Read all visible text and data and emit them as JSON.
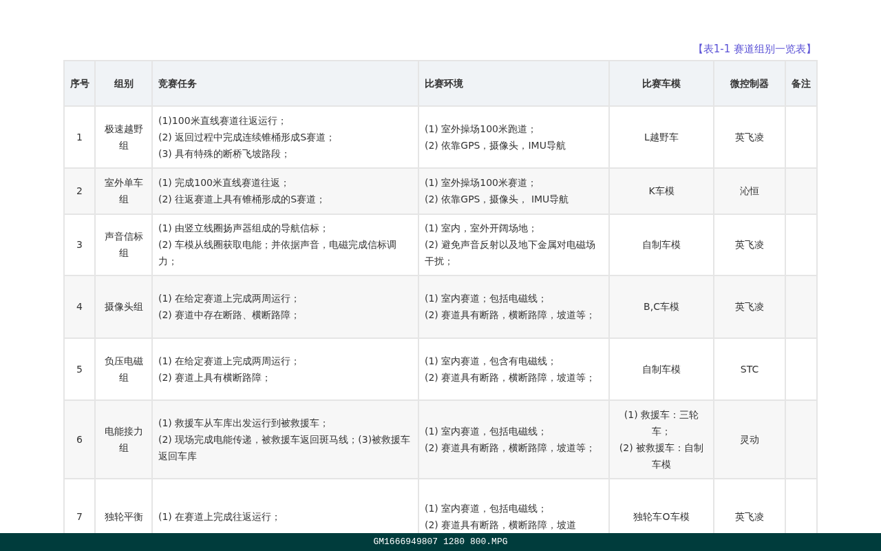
{
  "caption": "【表1-1 赛道组别一览表】",
  "table": {
    "columns": [
      "序号",
      "组别",
      "竞赛任务",
      "比赛环境",
      "比赛车模",
      "微控制器",
      "备注"
    ],
    "rows": [
      {
        "no": "1",
        "group": "极速越野组",
        "tasks": [
          "(1)100米直线赛道往返运行；",
          "(2) 返回过程中完成连续锥桶形成S赛道；",
          "(3) 具有特殊的断桥飞坡路段；"
        ],
        "env": [
          "(1) 室外操场100米跑道；",
          "(2) 依靠GPS，摄像头，IMU导航"
        ],
        "car": [
          "L越野车"
        ],
        "mcu": "英飞凌"
      },
      {
        "no": "2",
        "group": "室外单车组",
        "tasks": [
          "(1) 完成100米直线赛道往返；",
          "(2) 往返赛道上具有锥桶形成的S赛道；"
        ],
        "env": [
          "(1) 室外操场100米赛道；",
          "(2) 依靠GPS，摄像头， IMU导航"
        ],
        "car": [
          "K车模"
        ],
        "mcu": "沁恒"
      },
      {
        "no": "3",
        "group": "声音信标组",
        "tasks": [
          "(1) 由竖立线圈扬声器组成的导航信标；",
          "(2) 车模从线圈获取电能；并依据声音，电磁完成信标调力；"
        ],
        "env": [
          "(1) 室内，室外开阔场地；",
          "(2) 避免声音反射以及地下金属对电磁场干扰；"
        ],
        "car": [
          "自制车模"
        ],
        "mcu": "英飞凌"
      },
      {
        "no": "4",
        "group": "摄像头组",
        "tasks": [
          "(1) 在给定赛道上完成两周运行；",
          "(2) 赛道中存在断路、横断路障；"
        ],
        "env": [
          "(1) 室内赛道；包括电磁线；",
          "(2) 赛道具有断路，横断路障，坡道等；"
        ],
        "car": [
          "B,C车模"
        ],
        "mcu": "英飞凌"
      },
      {
        "no": "5",
        "group": "负压电磁组",
        "tasks": [
          "(1) 在给定赛道上完成两周运行；",
          "(2) 赛道上具有横断路障；"
        ],
        "env": [
          "(1) 室内赛道，包含有电磁线；",
          "(2) 赛道具有断路，横断路障，坡道等；"
        ],
        "car": [
          "自制车模"
        ],
        "mcu": "STC"
      },
      {
        "no": "6",
        "group": "电能接力组",
        "tasks": [
          "(1) 救援车从车库出发运行到被救援车；",
          "(2) 现场完成电能传递，被救援车返回斑马线；(3)被救援车返回车库"
        ],
        "env": [
          "(1) 室内赛道，包括电磁线；",
          "(2) 赛道具有断路，横断路障，坡道等；"
        ],
        "car": [
          "(1) 救援车：三轮车；",
          "(2) 被救援车：自制车模"
        ],
        "mcu": "灵动"
      },
      {
        "no": "7",
        "group": "独轮平衡",
        "tasks": [
          "(1) 在赛道上完成往返运行；"
        ],
        "env": [
          "(1) 室内赛道，包括电磁线；",
          "(2) 赛道具有断路，横断路障，坡道"
        ],
        "car": [
          "独轮车O车模"
        ],
        "mcu": "英飞凌"
      }
    ]
  },
  "status_bar": "GM1666949807 1280 800.MPG"
}
